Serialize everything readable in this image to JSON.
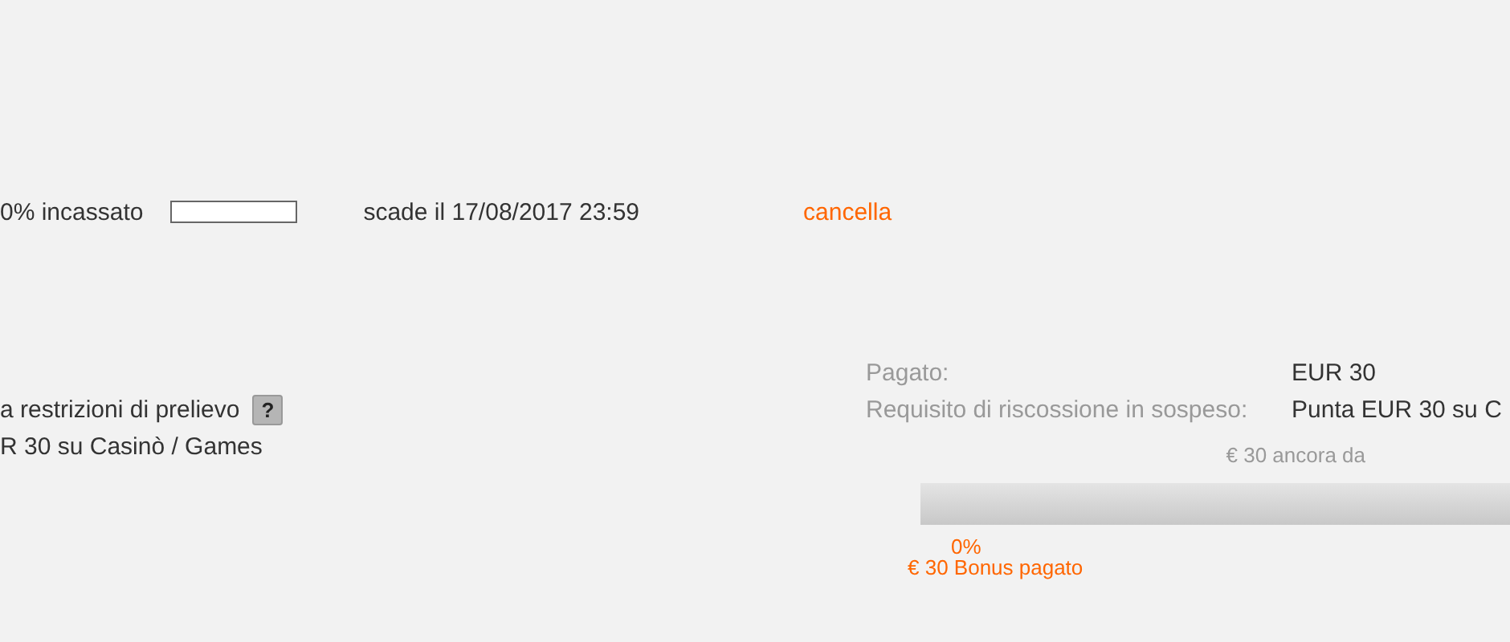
{
  "bonus_row": {
    "collected": "0% incassato",
    "collected_bar": {
      "level": 0
    },
    "expiry": "scade il 17/08/2017 23:59",
    "cancel_link": "cancella"
  },
  "details": {
    "left_lines": [
      {
        "text": "a restrizioni di prelievo",
        "help": "?"
      },
      {
        "text": "R 30 su Casinò / Games"
      }
    ],
    "fields": [
      {
        "label": "Pagato:",
        "value": "EUR 30"
      },
      {
        "label": "Requisito di riscossione in sospeso:",
        "value": "Punta EUR 30 su C"
      }
    ],
    "remaining": "€ 30 ancora da",
    "progress": {
      "level": 0,
      "percent": "0%",
      "paid": "€ 30 Bonus pagato"
    }
  }
}
